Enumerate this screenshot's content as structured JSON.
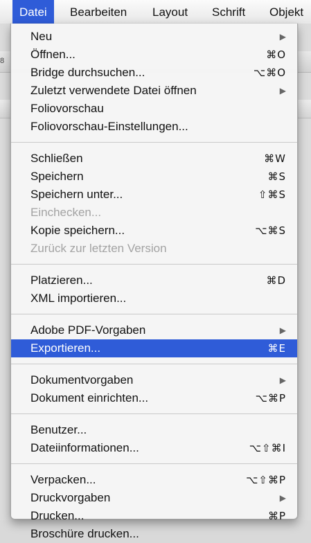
{
  "menubar": {
    "items": [
      "Datei",
      "Bearbeiten",
      "Layout",
      "Schrift",
      "Objekt"
    ],
    "active_index": 0
  },
  "background": {
    "ruler_glyph": "8"
  },
  "menu": {
    "groups": [
      [
        {
          "label": "Neu",
          "shortcut": "",
          "submenu": true,
          "enabled": true
        },
        {
          "label": "Öffnen...",
          "shortcut": "⌘O",
          "submenu": false,
          "enabled": true
        },
        {
          "label": "Bridge durchsuchen...",
          "shortcut": "⌥⌘O",
          "submenu": false,
          "enabled": true
        },
        {
          "label": "Zuletzt verwendete Datei öffnen",
          "shortcut": "",
          "submenu": true,
          "enabled": true
        },
        {
          "label": "Foliovorschau",
          "shortcut": "",
          "submenu": false,
          "enabled": true
        },
        {
          "label": "Foliovorschau-Einstellungen...",
          "shortcut": "",
          "submenu": false,
          "enabled": true
        }
      ],
      [
        {
          "label": "Schließen",
          "shortcut": "⌘W",
          "submenu": false,
          "enabled": true
        },
        {
          "label": "Speichern",
          "shortcut": "⌘S",
          "submenu": false,
          "enabled": true
        },
        {
          "label": "Speichern unter...",
          "shortcut": "⇧⌘S",
          "submenu": false,
          "enabled": true
        },
        {
          "label": "Einchecken...",
          "shortcut": "",
          "submenu": false,
          "enabled": false
        },
        {
          "label": "Kopie speichern...",
          "shortcut": "⌥⌘S",
          "submenu": false,
          "enabled": true
        },
        {
          "label": "Zurück zur letzten Version",
          "shortcut": "",
          "submenu": false,
          "enabled": false
        }
      ],
      [
        {
          "label": "Platzieren...",
          "shortcut": "⌘D",
          "submenu": false,
          "enabled": true
        },
        {
          "label": "XML importieren...",
          "shortcut": "",
          "submenu": false,
          "enabled": true
        }
      ],
      [
        {
          "label": "Adobe PDF-Vorgaben",
          "shortcut": "",
          "submenu": true,
          "enabled": true
        },
        {
          "label": "Exportieren...",
          "shortcut": "⌘E",
          "submenu": false,
          "enabled": true,
          "highlighted": true
        }
      ],
      [
        {
          "label": "Dokumentvorgaben",
          "shortcut": "",
          "submenu": true,
          "enabled": true
        },
        {
          "label": "Dokument einrichten...",
          "shortcut": "⌥⌘P",
          "submenu": false,
          "enabled": true
        }
      ],
      [
        {
          "label": "Benutzer...",
          "shortcut": "",
          "submenu": false,
          "enabled": true
        },
        {
          "label": "Dateiinformationen...",
          "shortcut": "⌥⇧⌘I",
          "submenu": false,
          "enabled": true
        }
      ],
      [
        {
          "label": "Verpacken...",
          "shortcut": "⌥⇧⌘P",
          "submenu": false,
          "enabled": true
        },
        {
          "label": "Druckvorgaben",
          "shortcut": "",
          "submenu": true,
          "enabled": true
        },
        {
          "label": "Drucken...",
          "shortcut": "⌘P",
          "submenu": false,
          "enabled": true
        },
        {
          "label": "Broschüre drucken...",
          "shortcut": "",
          "submenu": false,
          "enabled": true
        }
      ]
    ]
  },
  "icons": {
    "submenu_arrow": "▶"
  },
  "colors": {
    "highlight": "#2f5cd8"
  }
}
